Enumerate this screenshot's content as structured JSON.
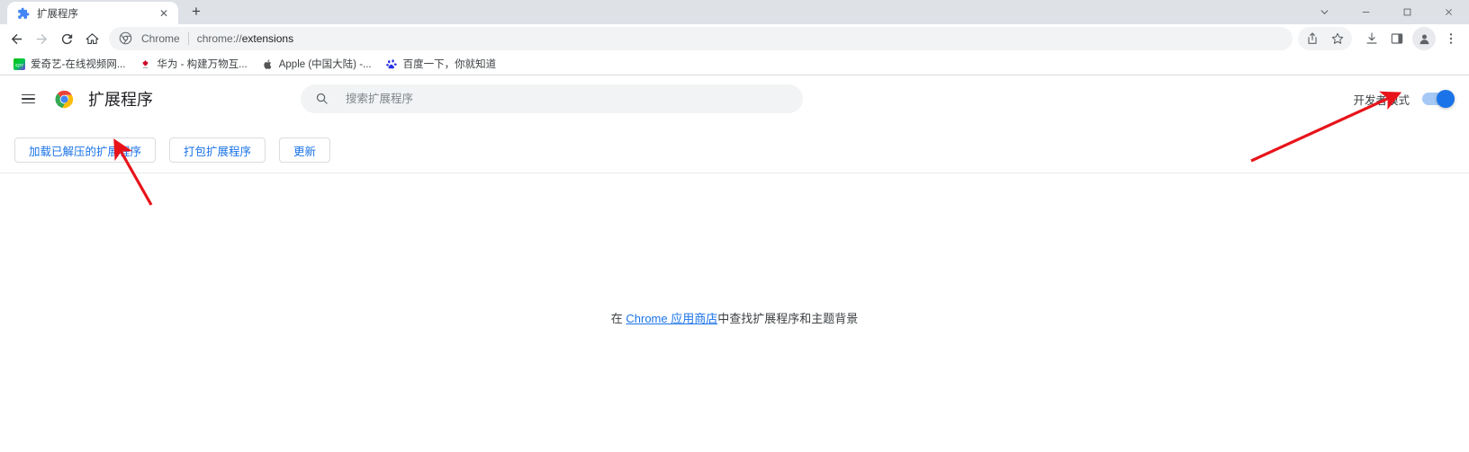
{
  "window": {
    "controls": [
      {
        "name": "tab-search",
        "glyph": "⌄"
      },
      {
        "name": "minimize",
        "glyph": "—"
      },
      {
        "name": "maximize",
        "glyph": "□"
      },
      {
        "name": "close",
        "glyph": "✕"
      }
    ]
  },
  "tabs": [
    {
      "title": "扩展程序",
      "favicon": "extension-puzzle-icon",
      "close_glyph": "✕",
      "active": true
    }
  ],
  "newtab": {
    "label": "+"
  },
  "toolbar": {
    "back": "←",
    "forward": "→",
    "reload": "⟳",
    "home": "⌂",
    "omnibox": {
      "secure_label": "Chrome",
      "url_scheme": "chrome://",
      "url_path": "extensions",
      "full_url": "chrome://extensions"
    },
    "right_buttons": [
      {
        "name": "share-icon",
        "label": "Share"
      },
      {
        "name": "bookmark-star-icon",
        "label": "Bookmark"
      },
      {
        "name": "download-icon",
        "label": "Downloads"
      },
      {
        "name": "side-panel-icon",
        "label": "Side panel"
      },
      {
        "name": "profile-avatar-icon",
        "label": "Profile"
      },
      {
        "name": "chrome-menu-icon",
        "label": "Customize and control Google Chrome"
      }
    ]
  },
  "bookmarks": [
    {
      "label": "爱奇艺-在线视频网...",
      "icon": "iqiyi-icon"
    },
    {
      "label": "华为 - 构建万物互...",
      "icon": "huawei-icon"
    },
    {
      "label": "Apple (中国大陆) -...",
      "icon": "apple-icon"
    },
    {
      "label": "百度一下，你就知道",
      "icon": "baidu-icon"
    }
  ],
  "extensions_page": {
    "menu_button": "menu-icon",
    "logo": "chrome-logo-icon",
    "title": "扩展程序",
    "search": {
      "icon": "search-icon",
      "placeholder": "搜索扩展程序",
      "value": ""
    },
    "developer_mode": {
      "label": "开发者模式",
      "enabled": true
    },
    "actions": [
      {
        "label": "加载已解压的扩展程序",
        "name": "load-unpacked-button"
      },
      {
        "label": "打包扩展程序",
        "name": "pack-extension-button"
      },
      {
        "label": "更新",
        "name": "update-button"
      }
    ],
    "empty_state": {
      "prefix": "在 ",
      "link_text": "Chrome 应用商店",
      "suffix": "中查找扩展程序和主题背景"
    }
  },
  "annotations": {
    "arrow_color": "#e8131a",
    "arrows": [
      {
        "name": "arrow-to-load-unpacked",
        "points_to": "load-unpacked-button"
      },
      {
        "name": "arrow-to-developer-mode",
        "points_to": "developer-mode-toggle"
      }
    ]
  },
  "colors": {
    "accent": "#1a73e8",
    "titlebar": "#dee1e6",
    "omnibox_bg": "#f1f3f4",
    "text": "#202124"
  }
}
